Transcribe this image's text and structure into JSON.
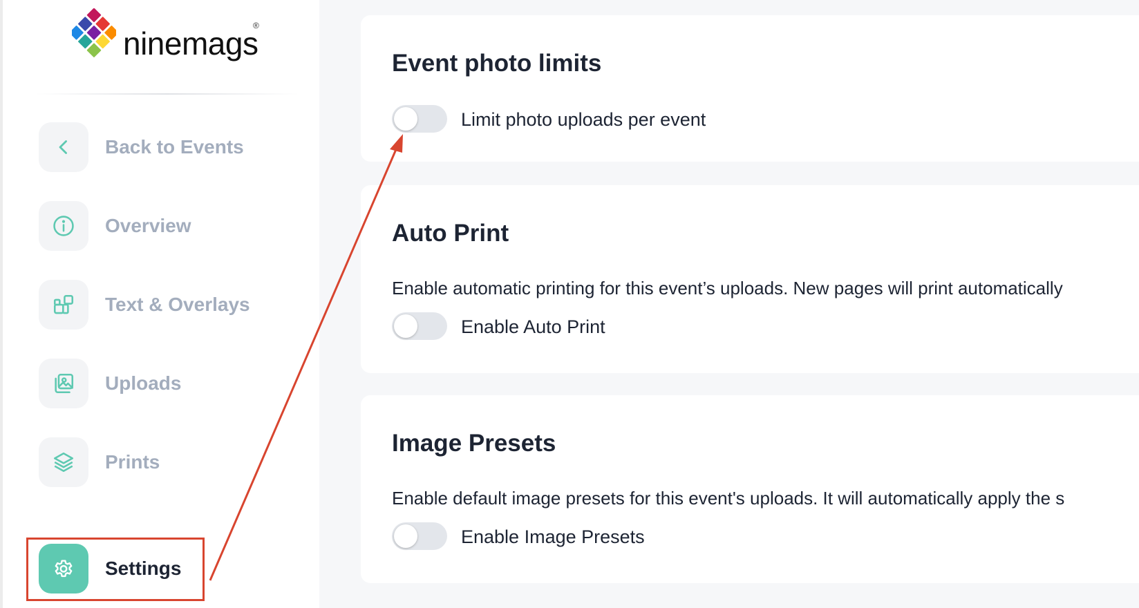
{
  "brand": {
    "name": "ninemags",
    "registered_mark": "®",
    "logo_colors": [
      "#c2185b",
      "#3949ab",
      "#e53935",
      "#7b1fa2",
      "#1e88e5",
      "#fb8c00",
      "#26a69a",
      "#8bc34a",
      "#fdd835"
    ]
  },
  "sidebar": {
    "items": [
      {
        "label": "Back to Events",
        "icon": "chevron-left-icon",
        "active": false
      },
      {
        "label": "Overview",
        "icon": "info-icon",
        "active": false
      },
      {
        "label": "Text & Overlays",
        "icon": "overlays-icon",
        "active": false
      },
      {
        "label": "Uploads",
        "icon": "photos-icon",
        "active": false
      },
      {
        "label": "Prints",
        "icon": "layers-icon",
        "active": false
      },
      {
        "label": "Settings",
        "icon": "gear-icon",
        "active": true
      }
    ]
  },
  "main": {
    "sections": [
      {
        "title": "Event photo limits",
        "description": "",
        "toggle": {
          "label": "Limit photo uploads per event",
          "enabled": false
        }
      },
      {
        "title": "Auto Print",
        "description": "Enable automatic printing for this event’s uploads. New pages will print automatically",
        "toggle": {
          "label": "Enable Auto Print",
          "enabled": false
        }
      },
      {
        "title": "Image Presets",
        "description": "Enable default image presets for this event's uploads. It will automatically apply the s",
        "toggle": {
          "label": "Enable Image Presets",
          "enabled": false
        }
      }
    ]
  },
  "annotation": {
    "color": "#d8452f"
  },
  "colors": {
    "accent": "#5ec9b1",
    "inactive_text": "#a3adbd",
    "active_text": "#1d2433",
    "toggle_off": "#e3e6eb"
  }
}
